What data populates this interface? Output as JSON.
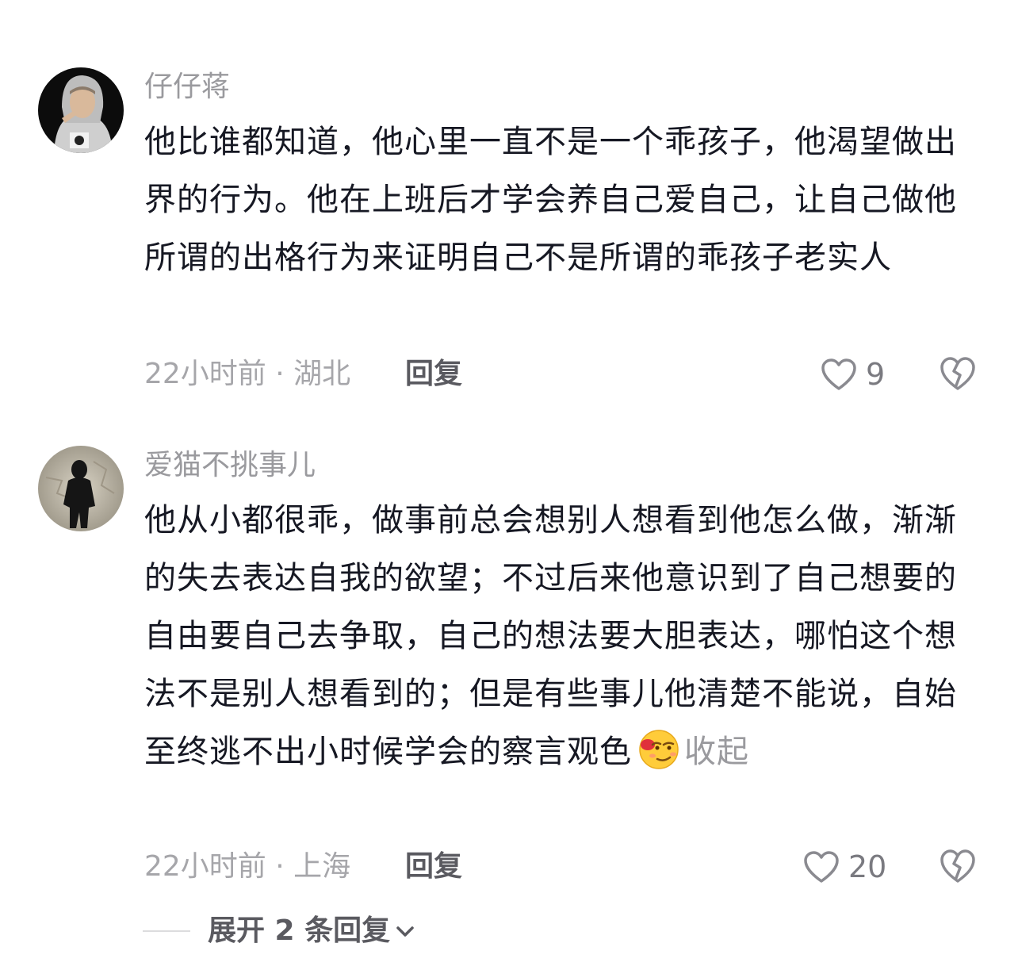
{
  "comments": [
    {
      "username": "仔仔蒋",
      "text": "他比谁都知道，他心里一直不是一个乖孩子，他渴望做出界的行为。他在上班后才学会养自己爱自己，让自己做他所谓的出格行为来证明自己不是所谓的乖孩子老实人",
      "meta": "22小时前 · 湖北",
      "reply_label": "回复",
      "likes": "9",
      "avatar_icon": "hooded-person-avatar"
    },
    {
      "username": "爱猫不挑事儿",
      "text": "他从小都很乖，做事前总会想别人想看到他怎么做，渐渐的失去表达自我的欲望；不过后来他意识到了自己想要的自由要自己去争取，自己的想法要大胆表达，哪怕这个想法不是别人想看到的；但是有些事儿他清楚不能说，自始至终逃不出小时候学会的察言观色",
      "collapse_label": "收起",
      "meta": "22小时前 · 上海",
      "reply_label": "回复",
      "likes": "20",
      "avatar_icon": "shadow-figure-avatar",
      "emoji_icon": "smirking-tipsy-emoji"
    }
  ],
  "expand_replies_label": "展开 2 条回复",
  "icons": {
    "like": "heart-outline-icon",
    "dislike": "broken-heart-icon",
    "expand": "chevron-down-icon"
  },
  "colors": {
    "text_primary": "#161823",
    "text_secondary": "#9a9a9e",
    "action": "#5a5a60"
  }
}
